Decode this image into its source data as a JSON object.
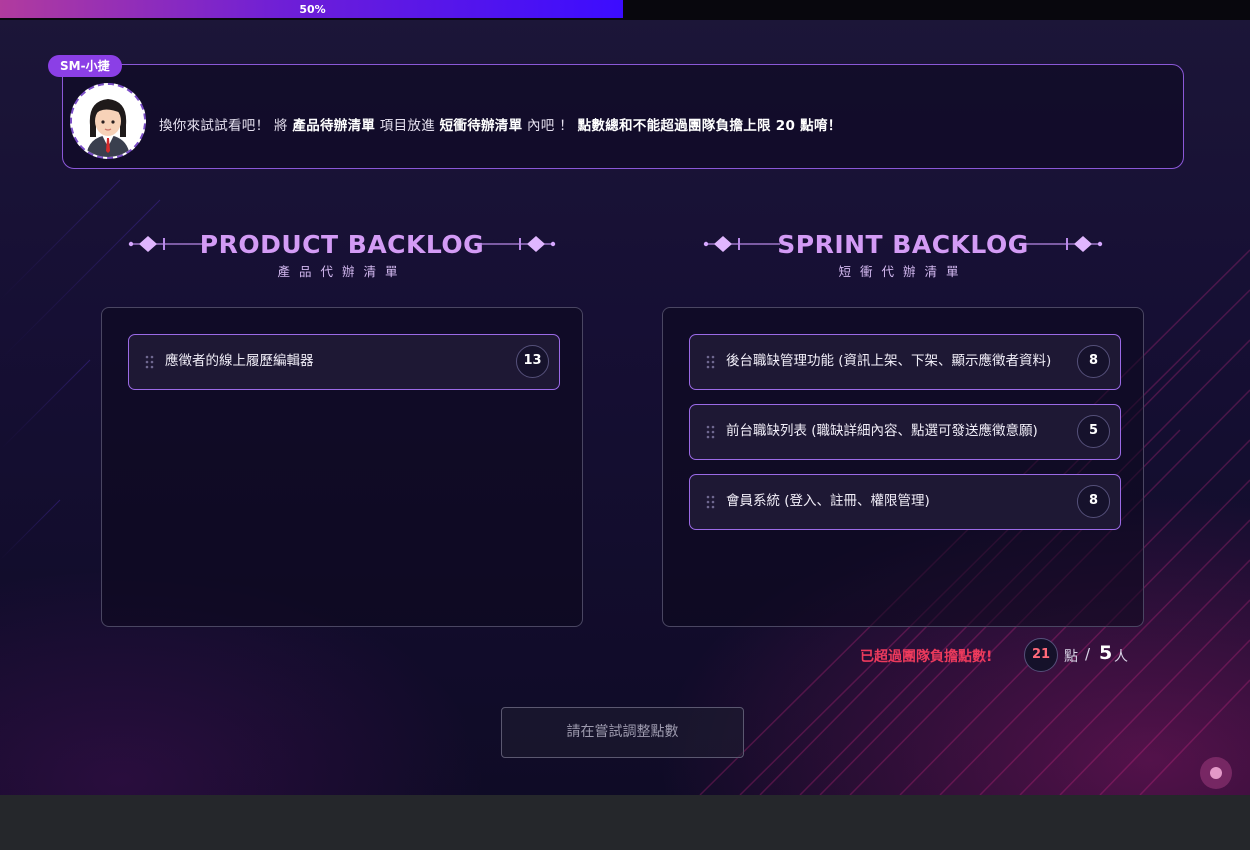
{
  "progress": {
    "label": "50%",
    "value": 0.5
  },
  "dialog": {
    "speaker": "SM-小捷",
    "segments": [
      {
        "text": "換你來試試看吧！ 將 ",
        "bold": false
      },
      {
        "text": "產品待辦清單",
        "bold": true
      },
      {
        "text": " 項目放進 ",
        "bold": false
      },
      {
        "text": "短衝待辦清單",
        "bold": true
      },
      {
        "text": " 內吧 ！ ",
        "bold": false
      },
      {
        "text": "點數總和不能超過團隊負擔上限 20 點唷！",
        "bold": true
      }
    ]
  },
  "product_backlog": {
    "title": "PRODUCT BACKLOG",
    "subtitle": "產品代辦清單",
    "items": [
      {
        "label": "應徵者的線上履歷編輯器",
        "points": "13"
      }
    ]
  },
  "sprint_backlog": {
    "title": "SPRINT BACKLOG",
    "subtitle": "短衝代辦清單",
    "items": [
      {
        "label": "後台職缺管理功能 (資訊上架、下架、顯示應徵者資料)",
        "points": "8"
      },
      {
        "label": "前台職缺列表 (職缺詳細內容、點選可發送應徵意願)",
        "points": "5"
      },
      {
        "label": "會員系統 (登入、註冊、權限管理)",
        "points": "8"
      }
    ]
  },
  "status": {
    "warning": "已超過團隊負擔點數!",
    "total_points": "21",
    "points_unit": "點",
    "slash": "/",
    "team_size": "5",
    "people_unit": "人"
  },
  "submit_button": {
    "label": "請在嘗試調整點數"
  },
  "colors": {
    "accent": "#8b3fe6",
    "title": "#d39bf5",
    "card_border": "#9b6ae6",
    "warning": "#ec3a5c"
  }
}
